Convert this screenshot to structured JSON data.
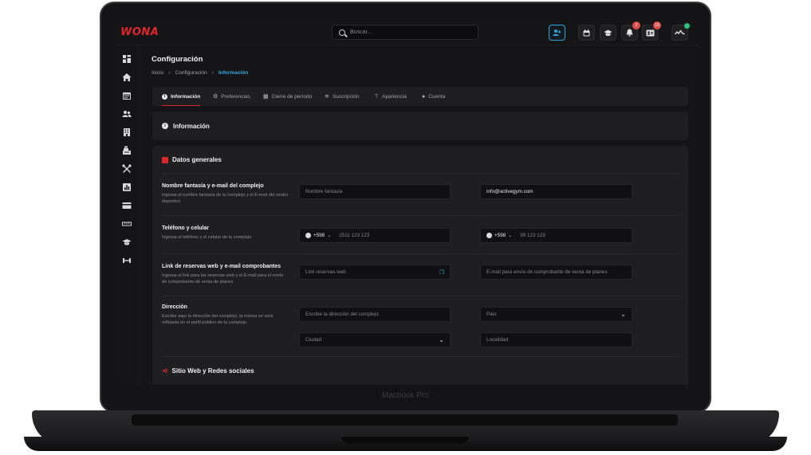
{
  "device": {
    "label": "Macbook Pro"
  },
  "topbar": {
    "logo": "WONA",
    "search_placeholder": "Buscar...",
    "buttons": [
      {
        "name": "add-user",
        "icon": "add-user-icon",
        "active": true
      },
      {
        "name": "calendar",
        "icon": "calendar-icon"
      },
      {
        "name": "graduation",
        "icon": "graduation-cap-icon"
      },
      {
        "name": "notifications",
        "icon": "bell-icon",
        "badge": "2"
      },
      {
        "name": "contact-card",
        "icon": "id-card-icon",
        "badge": "10"
      },
      {
        "name": "profile",
        "icon": "avatar-icon",
        "status": "online"
      }
    ]
  },
  "sidebar": {
    "items": [
      {
        "icon": "dashboard-icon"
      },
      {
        "icon": "home-icon"
      },
      {
        "icon": "calendar-icon"
      },
      {
        "icon": "users-icon"
      },
      {
        "icon": "building-icon"
      },
      {
        "icon": "cash-register-icon"
      },
      {
        "icon": "tools-icon"
      },
      {
        "icon": "chart-icon"
      },
      {
        "icon": "card-icon"
      },
      {
        "icon": "ruler-icon"
      },
      {
        "icon": "graduation-cap-icon"
      },
      {
        "icon": "dumbbell-icon"
      }
    ]
  },
  "page": {
    "title": "Configuración",
    "breadcrumb": [
      "Inicio",
      "Configuración",
      "Información"
    ]
  },
  "tabs": [
    {
      "label": "Información",
      "active": true
    },
    {
      "label": "Preferencias"
    },
    {
      "label": "Cierre de período"
    },
    {
      "label": "Suscripción"
    },
    {
      "label": "Apariencia"
    },
    {
      "label": "Cuenta"
    }
  ],
  "info_header": "Información",
  "form": {
    "section_title": "Datos generales",
    "rows": {
      "name_email": {
        "label": "Nombre fantasía y e-mail del complejo",
        "desc": "Ingresa el nombre fantasía de tu complejo y el E-mail del centro deportivo",
        "name_placeholder": "Nombre fantasía",
        "email_value": "info@activegym.com"
      },
      "phone": {
        "label": "Teléfono y celular",
        "desc": "Ingresa el teléfono y el celular de tu complejo",
        "phone_prefix": "+598",
        "phone_placeholder": "2511 123 123",
        "cell_prefix": "+598",
        "cell_placeholder": "99 123 123"
      },
      "links": {
        "label": "Link de reservas web y e-mail comprobantes",
        "desc": "Ingresa el link para las reservas web y el E-mail para el envío de comprobante de venta de planes",
        "link_placeholder": "Link reservas web",
        "email_placeholder": "E-mail para envío de comprobante de venta de planes"
      },
      "address": {
        "label": "Dirección",
        "desc": "Escribe aquí la dirección del complejo, la misma se verá reflejada en el perfil público de tu complejo.",
        "address_placeholder": "Escribe la dirección del complejo",
        "country_value": "País",
        "city_value": "Ciudad",
        "locality_placeholder": "Localidad"
      }
    },
    "next_section_title": "Sitio Web y Redes sociales"
  }
}
